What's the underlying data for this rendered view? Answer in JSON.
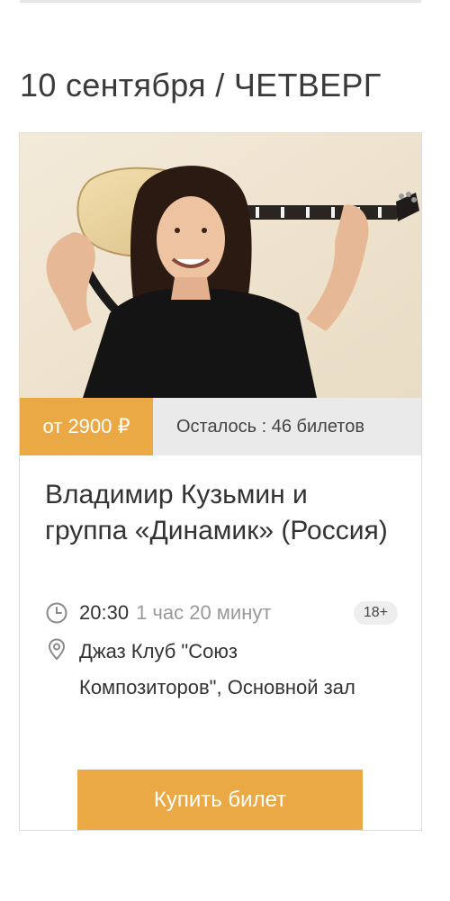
{
  "header": {
    "date_heading": "10 сентября / ЧЕТВЕРГ"
  },
  "event": {
    "photo_alt": "Владимир Кузьмин",
    "price": "от 2900 ₽",
    "remaining": "Осталось : 46 билетов",
    "title": "Владимир Кузьмин и группа «Динамик» (Россия)",
    "time": "20:30",
    "duration": "1 час 20 минут",
    "age_rating": "18+",
    "venue": "Джаз Клуб \"Союз Композиторов\", Основной зал",
    "buy_label": "Купить билет"
  },
  "colors": {
    "accent": "#eba945",
    "remaining_bg": "#eaeaea",
    "badge_bg": "#eeeeee"
  },
  "icons": {
    "time": "clock-icon",
    "venue": "location-pin-icon"
  }
}
